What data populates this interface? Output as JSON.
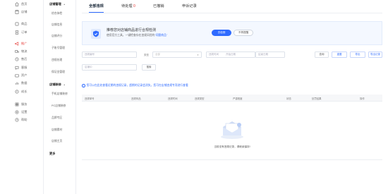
{
  "rail": {
    "items": [
      "首页",
      "店铺",
      "商品",
      "订单",
      "推广",
      "物流",
      "售后",
      "客服",
      "资产",
      "数据",
      "成长",
      "服务",
      "设置",
      "帮助"
    ]
  },
  "submenu": {
    "section1": "店铺管理",
    "section1_items": [
      "综合体检",
      "店铺信息",
      "店铺评分",
      "子账号管理",
      "违规处理",
      "保证金管理"
    ],
    "section2": "店铺装修",
    "section2_items": [
      "手机店铺装修",
      "PC店铺装修",
      "品牌专区",
      "店铺素材",
      "店铺主页"
    ],
    "section3": "更多"
  },
  "tabs": {
    "all": "全部违规",
    "pending": "待处理",
    "pending_count": "0",
    "revoked": "已撤销",
    "appeal": "申诉记录"
  },
  "banner": {
    "title": "推荐您对店铺商品进行合规检测",
    "sub_prefix": "使用官方工具，一键检查存在违规风险的",
    "sub_highlight": "“问题商品”",
    "primary_btn": "去检测",
    "ghost_btn": "不再提醒"
  },
  "filters": {
    "violation_id_ph": "违规编号",
    "type_label": "类型",
    "type_ph": "全部",
    "time_label": "违规时间",
    "start_ph": "开始日期",
    "end_ph": "结束日期",
    "btn_query": "查询",
    "btn_reset": "重置",
    "btn_export": "导出",
    "btn_records": "导出记录",
    "store_id_ph": "店铺ID",
    "btn_search": "搜索"
  },
  "notice": "您可以在此处查看近期的违规记录，超期的记录会消失，您可在店铺违规专项进行查看",
  "table": {
    "columns": [
      "违规单号",
      "违规商品",
      "违规时间",
      "违规类型",
      "严重程度",
      "状态",
      "处罚结果",
      "操作"
    ]
  },
  "empty_text": "当前没有违规记录，请继续保持!",
  "colors": {
    "accent": "#2f6bff",
    "active": "#e53935"
  }
}
